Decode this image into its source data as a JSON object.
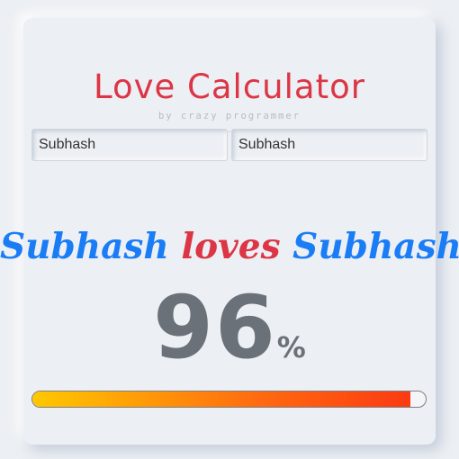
{
  "app": {
    "title": "Love Calculator",
    "subtitle": "by crazy programmer"
  },
  "inputs": {
    "name1": {
      "value": "Subhash",
      "placeholder": ""
    },
    "name2": {
      "value": "Subhash",
      "placeholder": ""
    }
  },
  "result": {
    "name1": "Subhash",
    "connector": "loves",
    "name2": "Subhash",
    "percent": "96",
    "percent_symbol": "%",
    "progress_fraction": 0.96
  },
  "colors": {
    "accent_red": "#dc3545",
    "name_blue": "#1a7df5",
    "number_gray": "#6b7178",
    "bar_start": "#ffc800",
    "bar_end": "#fb3b12"
  }
}
